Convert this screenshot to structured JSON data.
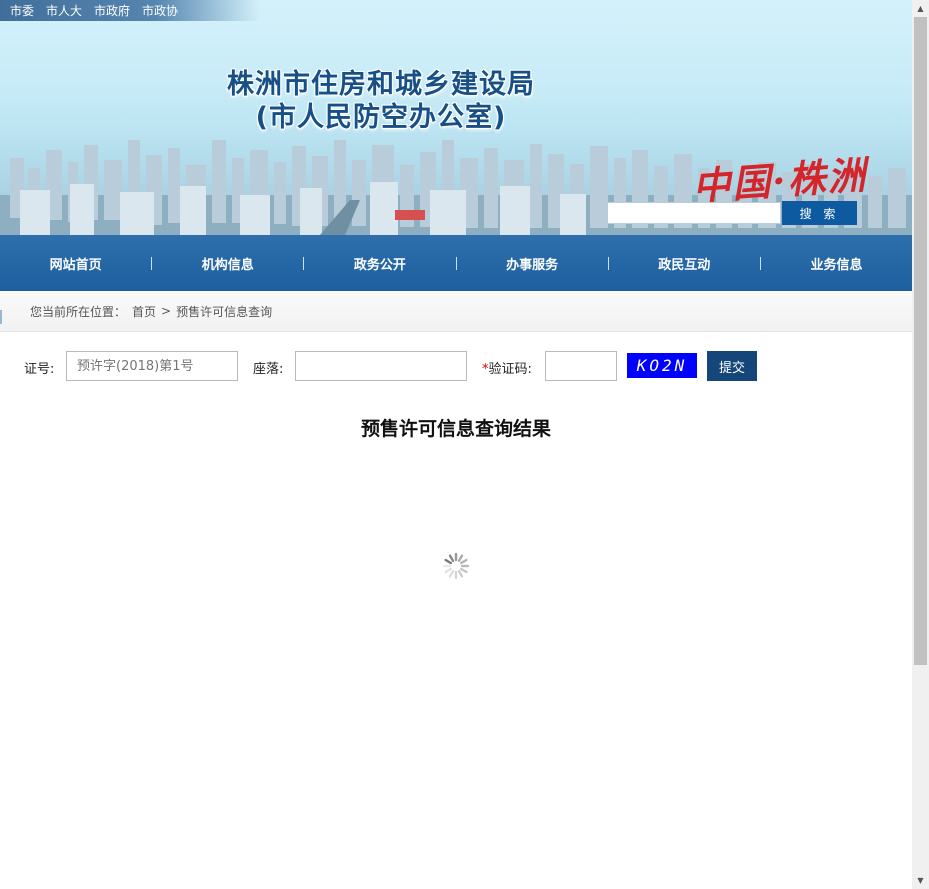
{
  "topbar": {
    "links": [
      "市委",
      "市人大",
      "市政府",
      "市政协"
    ]
  },
  "banner": {
    "title_line1": "株洲市住房和城乡建设局",
    "title_line2": "(市人民防空办公室)",
    "calligraphy": "中国·株洲",
    "search_button": "搜 索",
    "search_value": ""
  },
  "nav": {
    "items": [
      "网站首页",
      "机构信息",
      "政务公开",
      "办事服务",
      "政民互动",
      "业务信息"
    ]
  },
  "breadcrumb": {
    "prefix": "您当前所在位置：",
    "home": "首页",
    "separator": ">",
    "current": "预售许可信息查询"
  },
  "form": {
    "cert_label": "证号:",
    "cert_placeholder": "预许字(2018)第1号",
    "location_label": "座落:",
    "location_value": "",
    "captcha_required_mark": "*",
    "captcha_label": "验证码:",
    "captcha_value": "",
    "captcha_image_text": "KO2N",
    "submit_label": "提交"
  },
  "result": {
    "title": "预售许可信息查询结果",
    "loading": true
  },
  "colors": {
    "nav_bg": "#1d5f9f",
    "title": "#174f87",
    "submit_bg": "#14467a",
    "captcha_bg": "#0000ff",
    "search_btn": "#0d5aa0"
  }
}
